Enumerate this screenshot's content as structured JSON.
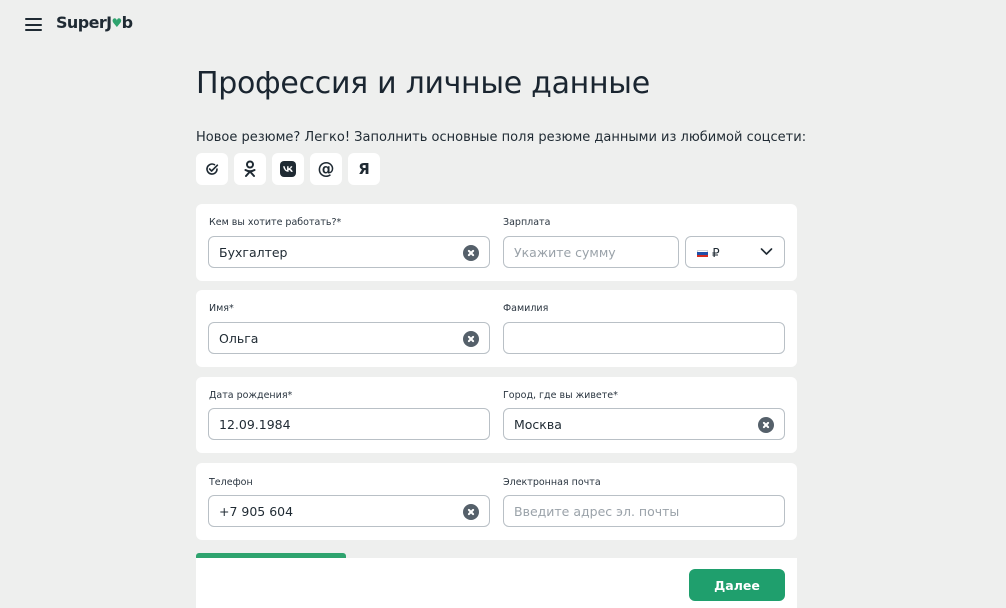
{
  "header": {
    "logo_text_a": "SuperJ",
    "logo_heart": "♥",
    "logo_text_b": "b"
  },
  "page": {
    "title": "Профессия и личные данные",
    "intro": "Новое резюме? Легко! Заполнить основные поля резюме данными из любимой соцсети:"
  },
  "social": [
    {
      "icon": "check-circle-icon",
      "label": ""
    },
    {
      "icon": "odnoklassniki-icon",
      "label": ""
    },
    {
      "icon": "vk-icon",
      "label": ""
    },
    {
      "icon": "mail-at-icon",
      "label": "@"
    },
    {
      "icon": "yandex-icon",
      "label": "Я"
    }
  ],
  "form": {
    "profession": {
      "label": "Кем вы хотите работать?*",
      "value": "Бухгалтер"
    },
    "salary": {
      "label": "Зарплата",
      "value": "",
      "placeholder": "Укажите сумму"
    },
    "currency": {
      "symbol": "₽",
      "flag_colors": [
        "#ffffff",
        "#1f4fa8",
        "#d52b1e"
      ]
    },
    "first_name": {
      "label": "Имя*",
      "value": "Ольга"
    },
    "last_name": {
      "label": "Фамилия",
      "value": ""
    },
    "birth_date": {
      "label": "Дата рождения*",
      "value": "12.09.1984"
    },
    "city": {
      "label": "Город, где вы живете*",
      "value": "Москва"
    },
    "phone": {
      "label": "Телефон",
      "value": "+7 905 604"
    },
    "email": {
      "label": "Электронная почта",
      "value": "",
      "placeholder": "Введите адрес эл. почты"
    }
  },
  "progress": {
    "fraction": 0.25,
    "color": "#2ea36e"
  },
  "actions": {
    "next_label": "Далее"
  },
  "colors": {
    "accent": "#1f9f6d",
    "background": "#eeefee"
  }
}
